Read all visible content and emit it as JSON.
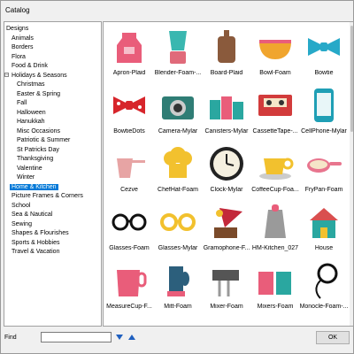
{
  "window": {
    "title": "Catalog"
  },
  "tree": {
    "items": [
      {
        "label": "Designs",
        "level": 0,
        "expander": ""
      },
      {
        "label": "Animals",
        "level": 1,
        "expander": ""
      },
      {
        "label": "Borders",
        "level": 1,
        "expander": ""
      },
      {
        "label": "Flora",
        "level": 1,
        "expander": ""
      },
      {
        "label": "Food & Drink",
        "level": 1,
        "expander": ""
      },
      {
        "label": "Holidays & Seasons",
        "level": 1,
        "expander": "−"
      },
      {
        "label": "Christmas",
        "level": 2,
        "expander": ""
      },
      {
        "label": "Easter & Spring",
        "level": 2,
        "expander": ""
      },
      {
        "label": "Fall",
        "level": 2,
        "expander": ""
      },
      {
        "label": "Halloween",
        "level": 2,
        "expander": ""
      },
      {
        "label": "Hanukkah",
        "level": 2,
        "expander": ""
      },
      {
        "label": "Misc Occasions",
        "level": 2,
        "expander": ""
      },
      {
        "label": "Patriotic & Summer",
        "level": 2,
        "expander": ""
      },
      {
        "label": "St Patricks Day",
        "level": 2,
        "expander": ""
      },
      {
        "label": "Thanksgiving",
        "level": 2,
        "expander": ""
      },
      {
        "label": "Valentine",
        "level": 2,
        "expander": ""
      },
      {
        "label": "Winter",
        "level": 2,
        "expander": ""
      },
      {
        "label": "Home & Kitchen",
        "level": 1,
        "expander": "",
        "selected": true
      },
      {
        "label": "Picture Frames & Corners",
        "level": 1,
        "expander": ""
      },
      {
        "label": "School",
        "level": 1,
        "expander": ""
      },
      {
        "label": "Sea & Nautical",
        "level": 1,
        "expander": ""
      },
      {
        "label": "Sewing",
        "level": 1,
        "expander": ""
      },
      {
        "label": "Shapes & Flourishes",
        "level": 1,
        "expander": ""
      },
      {
        "label": "Sports & Hobbies",
        "level": 1,
        "expander": ""
      },
      {
        "label": "Travel & Vacation",
        "level": 1,
        "expander": ""
      }
    ]
  },
  "gallery": {
    "items": [
      {
        "caption": "Apron-Plaid",
        "icon": "apron-icon",
        "color": "#e95d7a"
      },
      {
        "caption": "Blender-Foam-...",
        "icon": "blender-icon",
        "color": "#3ab7b0"
      },
      {
        "caption": "Board-Plaid",
        "icon": "cutting-board-icon",
        "color": "#8a5a3c"
      },
      {
        "caption": "Bowl-Foam",
        "icon": "bowl-icon",
        "color": "#f0a52e"
      },
      {
        "caption": "Bowtie",
        "icon": "bowtie-icon",
        "color": "#27a9c8"
      },
      {
        "caption": "BowtieDots",
        "icon": "bowtie-dots-icon",
        "color": "#d7252b"
      },
      {
        "caption": "Camera-Mylar",
        "icon": "camera-icon",
        "color": "#2f7d75"
      },
      {
        "caption": "Canisters-Mylar",
        "icon": "canisters-icon",
        "color": "#2aa7a0"
      },
      {
        "caption": "CassetteTape-...",
        "icon": "cassette-icon",
        "color": "#d23b3b"
      },
      {
        "caption": "CellPhone-Mylar",
        "icon": "cellphone-icon",
        "color": "#1f9fb5"
      },
      {
        "caption": "Cezve",
        "icon": "cezve-icon",
        "color": "#e7a4a4"
      },
      {
        "caption": "ChefHat-Foam",
        "icon": "chef-hat-icon",
        "color": "#f2c12e"
      },
      {
        "caption": "Clock-Mylar",
        "icon": "clock-icon",
        "color": "#222222"
      },
      {
        "caption": "CoffeeCup-Foa...",
        "icon": "coffee-cup-icon",
        "color": "#f2c12e"
      },
      {
        "caption": "FryPan-Foam",
        "icon": "frying-pan-icon",
        "color": "#e8758e"
      },
      {
        "caption": "Glasses-Foam",
        "icon": "glasses-icon",
        "color": "#111111"
      },
      {
        "caption": "Glasses-Mylar",
        "icon": "glasses-mylar-icon",
        "color": "#f2c12e"
      },
      {
        "caption": "Gramophone-F...",
        "icon": "gramophone-icon",
        "color": "#c3283a"
      },
      {
        "caption": "HM-Kitchen_027",
        "icon": "grater-icon",
        "color": "#9a9a9a"
      },
      {
        "caption": "House",
        "icon": "house-icon",
        "color": "#2aa7a0"
      },
      {
        "caption": "MeasureCup-F...",
        "icon": "measuring-cup-icon",
        "color": "#e95d7a"
      },
      {
        "caption": "Mitt-Foam",
        "icon": "oven-mitt-icon",
        "color": "#2c5f7c"
      },
      {
        "caption": "Mixer-Foam",
        "icon": "hand-mixer-icon",
        "color": "#555555"
      },
      {
        "caption": "Mixers-Foam",
        "icon": "stand-mixers-icon",
        "color": "#e95d7a"
      },
      {
        "caption": "Monocle-Foam-...",
        "icon": "monocle-icon",
        "color": "#111111"
      }
    ]
  },
  "find": {
    "label": "Find",
    "value": ""
  },
  "buttons": {
    "ok": "OK"
  }
}
